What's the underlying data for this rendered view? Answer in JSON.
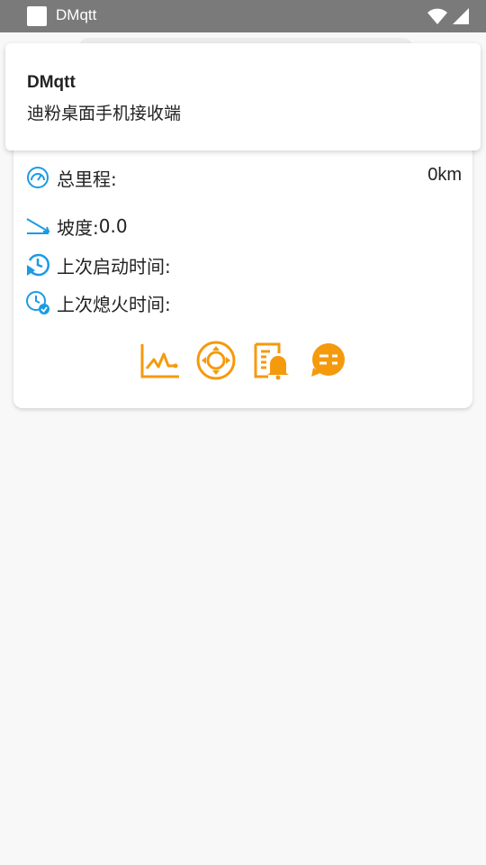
{
  "status_bar": {
    "app_title": "DMqtt"
  },
  "notification": {
    "title": "DMqtt",
    "text": "迪粉桌面手机接收端"
  },
  "vehicle": {
    "odometer_label": "总里程:",
    "odometer_value": "0km",
    "slope_label": "坡度:",
    "slope_value": "0.0",
    "last_start_label": "上次启动时间:",
    "last_shutdown_label": "上次熄火时间:"
  },
  "colors": {
    "status_bar": "#7a7a7a",
    "info_icon_blue": "#1a9be6",
    "action_orange": "#f59a0c",
    "background": "#f8f8f8"
  },
  "icons": [
    "speedometer-icon",
    "slope-icon",
    "start-time-icon",
    "shutdown-time-icon",
    "chart-icon",
    "direction-icon",
    "notice-icon",
    "message-icon"
  ]
}
